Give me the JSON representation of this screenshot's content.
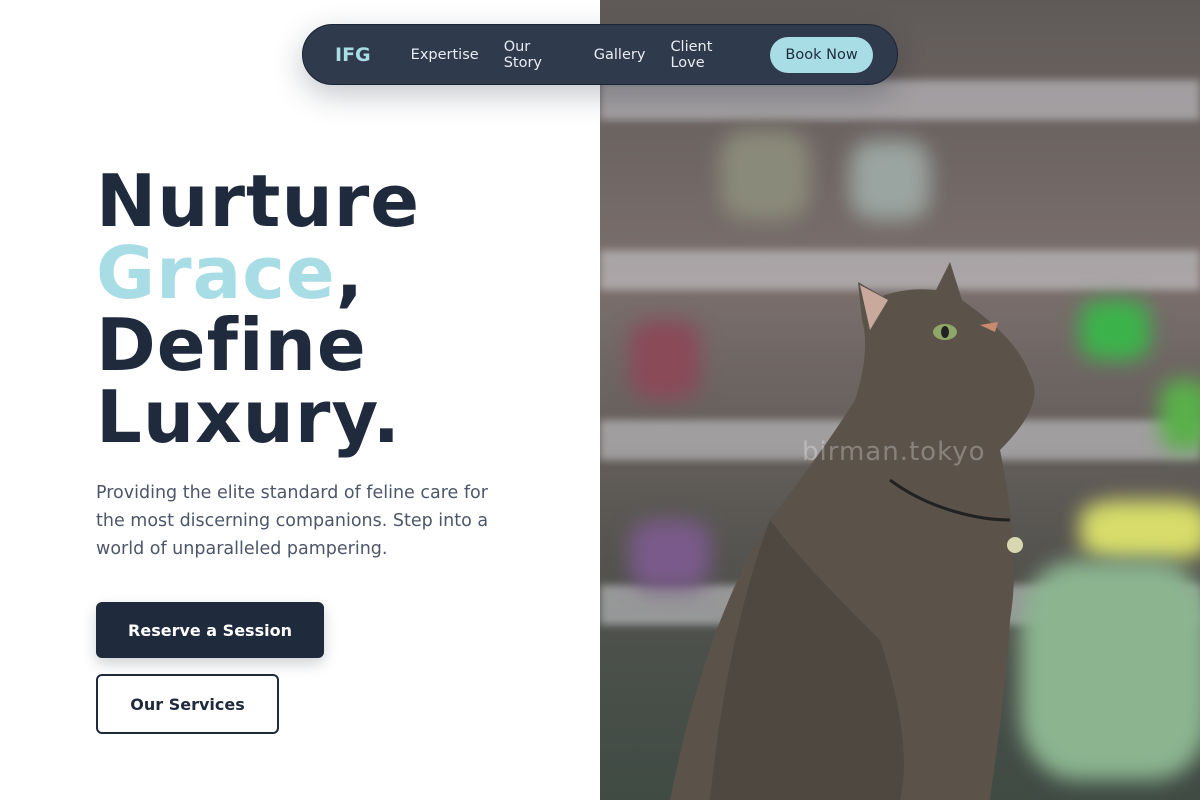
{
  "nav": {
    "logo": "IFG",
    "links": [
      "Expertise",
      "Our Story",
      "Gallery",
      "Client Love"
    ],
    "cta": "Book Now"
  },
  "hero": {
    "line1": "Nurture",
    "line2_accent": "Grace",
    "line2_rest": ",",
    "line3": "Define",
    "line4": "Luxury.",
    "subtitle": "Providing the elite standard of feline care for the most discerning companions. Step into a world of unparalleled pampering.",
    "primary_button": "Reserve a Session",
    "secondary_button": "Our Services"
  },
  "photo": {
    "watermark": "birman.tokyo"
  },
  "colors": {
    "navy": "#1f2a3d",
    "accent": "#a9dde5",
    "nav_bg": "#2f3a4d"
  }
}
